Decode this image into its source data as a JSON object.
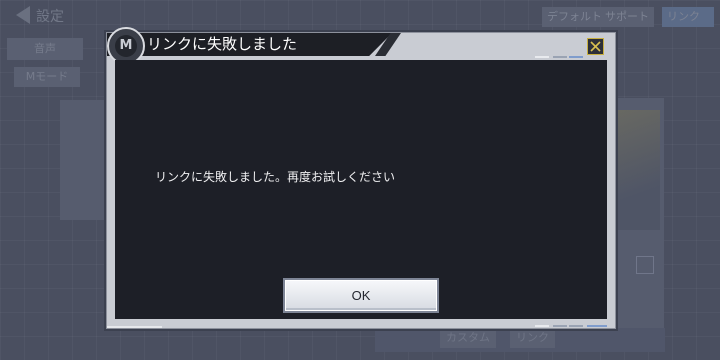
{
  "background": {
    "title": "設定",
    "tabs": [
      {
        "label": "デフォルト"
      },
      {
        "label": "サポート"
      },
      {
        "label": "リンク"
      }
    ],
    "buttons": [
      {
        "label": "音声"
      },
      {
        "label": "Mモード"
      }
    ],
    "bottom_tabs": [
      {
        "label": "カスタム"
      },
      {
        "label": "リンク"
      }
    ]
  },
  "dialog": {
    "title": "リンクに失敗しました",
    "message": "リンクに失敗しました。再度お試しください",
    "ok_label": "OK",
    "close_icon": "close-x-icon",
    "logo_icon": "game-logo-emblem",
    "logo_glyph": "M"
  },
  "colors": {
    "dialog_body": "#1d1f27",
    "dialog_frame": "#c9ccd3",
    "accent_blue": "#7f9ccc",
    "close_accent": "#c9b040",
    "backdrop": "#4a4f60"
  }
}
